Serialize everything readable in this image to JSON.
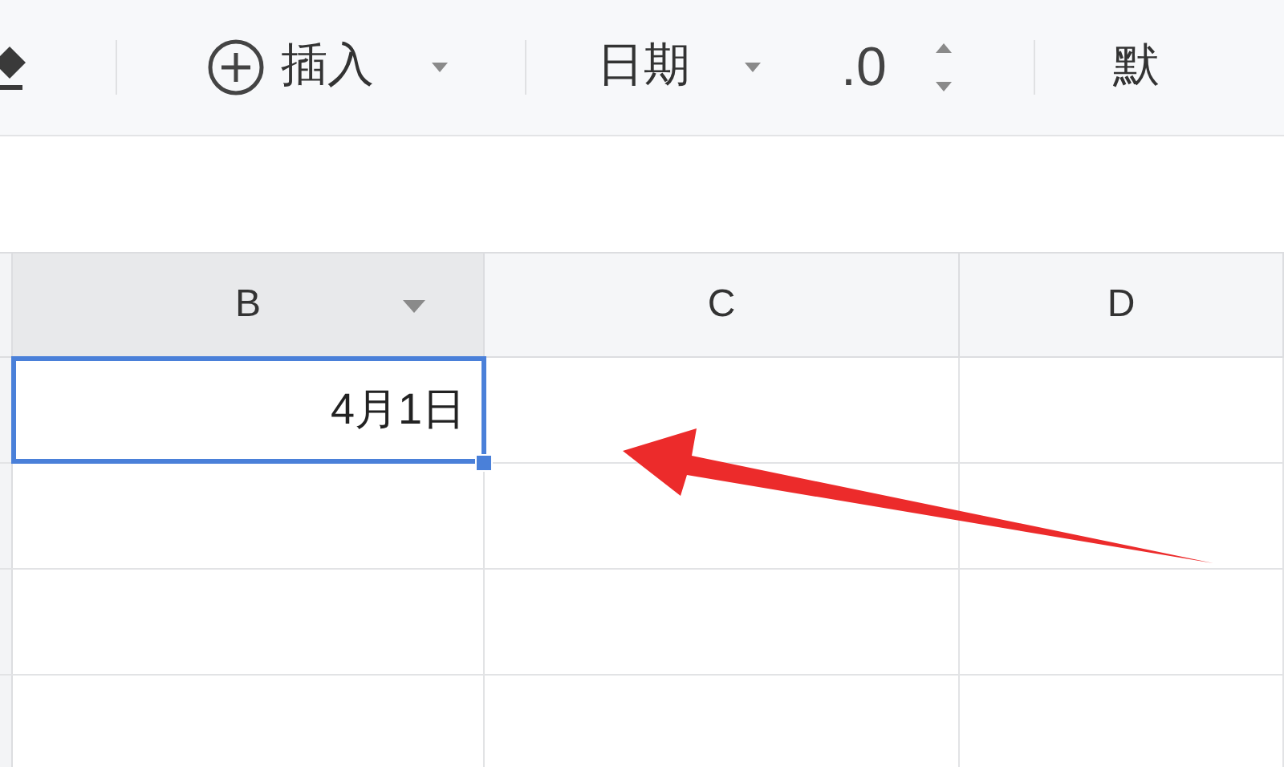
{
  "toolbar": [
    {
      "kind": "insert",
      "label": "插入"
    },
    {
      "kind": "dropdown",
      "label": "日期"
    },
    {
      "kind": "spinner",
      "label": ".0"
    },
    {
      "kind": "text",
      "label": "默"
    }
  ],
  "columns": [
    {
      "label": "B",
      "selected": true,
      "filter": true
    },
    {
      "label": "C",
      "selected": false,
      "filter": false
    },
    {
      "label": "D",
      "selected": false,
      "filter": false
    }
  ],
  "rows": [
    {
      "cells": [
        {
          "value": "4月1日",
          "selected": true
        }
      ]
    }
  ]
}
